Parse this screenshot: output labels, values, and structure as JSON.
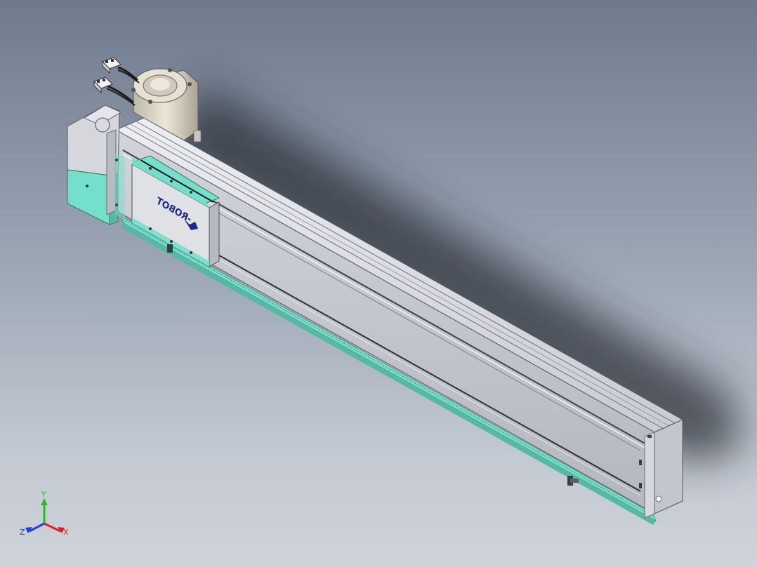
{
  "carriage": {
    "logo_text": "-ROBOT",
    "logo_mark": "robot-logo-icon"
  },
  "triad": {
    "x_label": "X",
    "y_label": "Y",
    "z_label": "Z"
  },
  "colors": {
    "background_top": "#6f7a8d",
    "background_bottom": "#cfd3da",
    "accent_teal": "#74e0cc",
    "body_light": "#dcdde2",
    "body_mid": "#c4c6cd",
    "body_dark": "#8c8e96",
    "axis_x": "#e02020",
    "axis_y": "#20c020",
    "axis_z": "#2040e0",
    "logo_blue": "#1b2a8a"
  }
}
